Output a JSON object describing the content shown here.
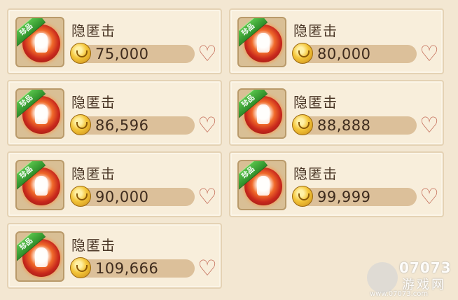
{
  "items": [
    {
      "rare_label": "珍品",
      "name": "隐匿击",
      "price": "75,000"
    },
    {
      "rare_label": "珍品",
      "name": "隐匿击",
      "price": "80,000"
    },
    {
      "rare_label": "珍品",
      "name": "隐匿击",
      "price": "86,596"
    },
    {
      "rare_label": "珍品",
      "name": "隐匿击",
      "price": "88,888"
    },
    {
      "rare_label": "珍品",
      "name": "隐匿击",
      "price": "90,000"
    },
    {
      "rare_label": "珍品",
      "name": "隐匿击",
      "price": "99,999"
    },
    {
      "rare_label": "珍品",
      "name": "隐匿击",
      "price": "109,666"
    }
  ],
  "icons": {
    "skill": "skill-fire-icon",
    "currency": "gold-coin-icon",
    "favorite": "heart-icon"
  },
  "watermark": {
    "brand": "07073",
    "sub": "游戏网",
    "url": "www.07073.com"
  },
  "colors": {
    "background": "#f3e7d2",
    "card": "#f8eedb",
    "rare_ribbon": "#3fa83a",
    "heart": "#c36b57"
  }
}
